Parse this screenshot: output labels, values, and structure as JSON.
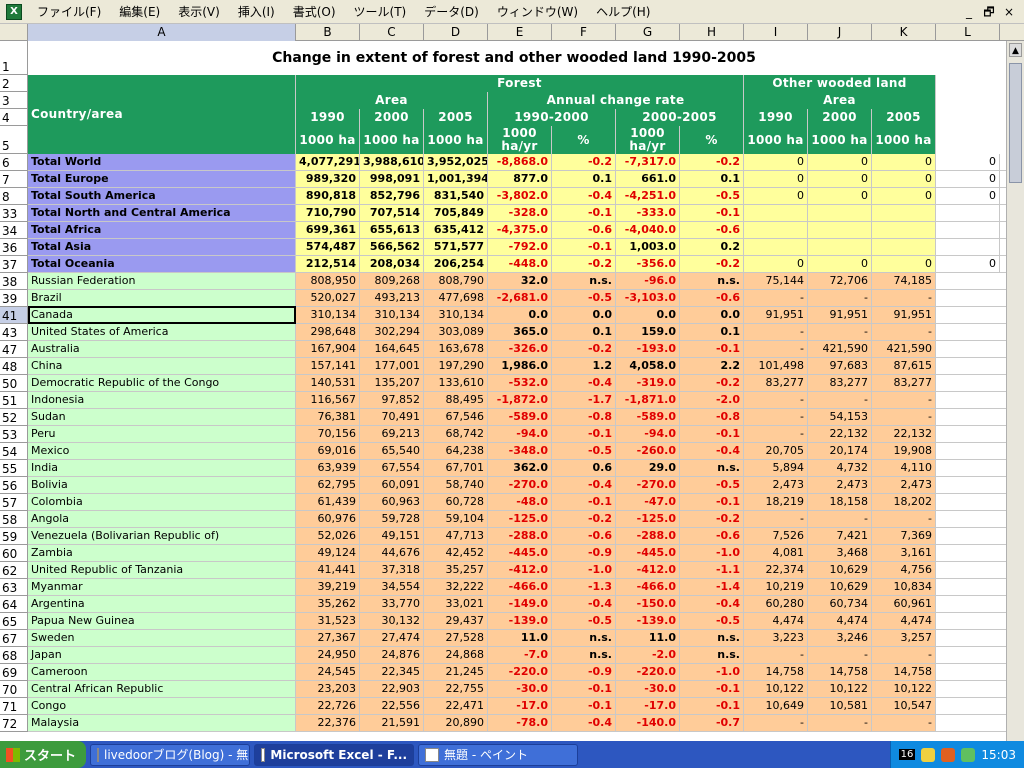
{
  "menubar": {
    "items": [
      "ファイル(F)",
      "編集(E)",
      "表示(V)",
      "挿入(I)",
      "書式(O)",
      "ツール(T)",
      "データ(D)",
      "ウィンドウ(W)",
      "ヘルプ(H)"
    ],
    "app_icon": "excel-icon",
    "controls": [
      "_",
      "🗗",
      "×"
    ]
  },
  "columns": [
    {
      "label": "A",
      "selected": true
    },
    {
      "label": "B"
    },
    {
      "label": "C"
    },
    {
      "label": "D"
    },
    {
      "label": "E"
    },
    {
      "label": "F"
    },
    {
      "label": "G"
    },
    {
      "label": "H"
    },
    {
      "label": "I"
    },
    {
      "label": "J"
    },
    {
      "label": "K"
    },
    {
      "label": "L"
    }
  ],
  "title": "Change in extent of forest and other wooded land 1990-2005",
  "header": {
    "country_area": "Country/area",
    "forest": "Forest",
    "other_wooded_land": "Other wooded land",
    "area": "Area",
    "annual_change_rate": "Annual change rate",
    "area2": "Area",
    "years": [
      "1990",
      "2000",
      "2005"
    ],
    "period1": "1990-2000",
    "period2": "2000-2005",
    "years2": [
      "1990",
      "2000",
      "2005"
    ],
    "unit_ha": "1000 ha",
    "unit_hayr": "1000 ha/yr",
    "unit_pct": "%"
  },
  "header_row_numbers": [
    "1",
    "2",
    "3",
    "4",
    "5"
  ],
  "totals": [
    {
      "row": "6",
      "name": "Total World",
      "b": "4,077,291",
      "c": "3,988,610",
      "d": "3,952,025",
      "e": "-8,868.0",
      "f": "-0.2",
      "g": "-7,317.0",
      "h": "-0.2",
      "i": "0",
      "j": "0",
      "k": "0",
      "l": "0"
    },
    {
      "row": "7",
      "name": "Total Europe",
      "b": "989,320",
      "c": "998,091",
      "d": "1,001,394",
      "e": "877.0",
      "f": "0.1",
      "g": "661.0",
      "h": "0.1",
      "i": "0",
      "j": "0",
      "k": "0",
      "l": "0"
    },
    {
      "row": "8",
      "name": "Total South America",
      "b": "890,818",
      "c": "852,796",
      "d": "831,540",
      "e": "-3,802.0",
      "f": "-0.4",
      "g": "-4,251.0",
      "h": "-0.5",
      "i": "0",
      "j": "0",
      "k": "0",
      "l": "0"
    },
    {
      "row": "33",
      "name": "Total North and Central America",
      "b": "710,790",
      "c": "707,514",
      "d": "705,849",
      "e": "-328.0",
      "f": "-0.1",
      "g": "-333.0",
      "h": "-0.1",
      "i": "",
      "j": "",
      "k": "",
      "l": ""
    },
    {
      "row": "34",
      "name": "Total Africa",
      "b": "699,361",
      "c": "655,613",
      "d": "635,412",
      "e": "-4,375.0",
      "f": "-0.6",
      "g": "-4,040.0",
      "h": "-0.6",
      "i": "",
      "j": "",
      "k": "",
      "l": ""
    },
    {
      "row": "36",
      "name": "Total Asia",
      "b": "574,487",
      "c": "566,562",
      "d": "571,577",
      "e": "-792.0",
      "f": "-0.1",
      "g": "1,003.0",
      "h": "0.2",
      "i": "",
      "j": "",
      "k": "",
      "l": ""
    },
    {
      "row": "37",
      "name": "Total Oceania",
      "b": "212,514",
      "c": "208,034",
      "d": "206,254",
      "e": "-448.0",
      "f": "-0.2",
      "g": "-356.0",
      "h": "-0.2",
      "i": "0",
      "j": "0",
      "k": "0",
      "l": "0"
    }
  ],
  "countries": [
    {
      "row": "38",
      "name": "Russian Federation",
      "b": "808,950",
      "c": "809,268",
      "d": "808,790",
      "e": "32.0",
      "f": "n.s.",
      "g": "-96.0",
      "h": "n.s.",
      "i": "75,144",
      "j": "72,706",
      "k": "74,185"
    },
    {
      "row": "39",
      "name": "Brazil",
      "b": "520,027",
      "c": "493,213",
      "d": "477,698",
      "e": "-2,681.0",
      "f": "-0.5",
      "g": "-3,103.0",
      "h": "-0.6",
      "i": "-",
      "j": "-",
      "k": "-"
    },
    {
      "row": "41",
      "name": "Canada",
      "b": "310,134",
      "c": "310,134",
      "d": "310,134",
      "e": "0.0",
      "f": "0.0",
      "g": "0.0",
      "h": "0.0",
      "i": "91,951",
      "j": "91,951",
      "k": "91,951"
    },
    {
      "row": "43",
      "name": "United States of America",
      "b": "298,648",
      "c": "302,294",
      "d": "303,089",
      "e": "365.0",
      "f": "0.1",
      "g": "159.0",
      "h": "0.1",
      "i": "-",
      "j": "-",
      "k": "-"
    },
    {
      "row": "47",
      "name": "Australia",
      "b": "167,904",
      "c": "164,645",
      "d": "163,678",
      "e": "-326.0",
      "f": "-0.2",
      "g": "-193.0",
      "h": "-0.1",
      "i": "-",
      "j": "421,590",
      "k": "421,590"
    },
    {
      "row": "48",
      "name": "China",
      "b": "157,141",
      "c": "177,001",
      "d": "197,290",
      "e": "1,986.0",
      "f": "1.2",
      "g": "4,058.0",
      "h": "2.2",
      "i": "101,498",
      "j": "97,683",
      "k": "87,615"
    },
    {
      "row": "50",
      "name": "Democratic Republic of the Congo",
      "b": "140,531",
      "c": "135,207",
      "d": "133,610",
      "e": "-532.0",
      "f": "-0.4",
      "g": "-319.0",
      "h": "-0.2",
      "i": "83,277",
      "j": "83,277",
      "k": "83,277"
    },
    {
      "row": "51",
      "name": "Indonesia",
      "b": "116,567",
      "c": "97,852",
      "d": "88,495",
      "e": "-1,872.0",
      "f": "-1.7",
      "g": "-1,871.0",
      "h": "-2.0",
      "i": "-",
      "j": "-",
      "k": "-"
    },
    {
      "row": "52",
      "name": "Sudan",
      "b": "76,381",
      "c": "70,491",
      "d": "67,546",
      "e": "-589.0",
      "f": "-0.8",
      "g": "-589.0",
      "h": "-0.8",
      "i": "-",
      "j": "54,153",
      "k": "-"
    },
    {
      "row": "53",
      "name": "Peru",
      "b": "70,156",
      "c": "69,213",
      "d": "68,742",
      "e": "-94.0",
      "f": "-0.1",
      "g": "-94.0",
      "h": "-0.1",
      "i": "-",
      "j": "22,132",
      "k": "22,132"
    },
    {
      "row": "54",
      "name": "Mexico",
      "b": "69,016",
      "c": "65,540",
      "d": "64,238",
      "e": "-348.0",
      "f": "-0.5",
      "g": "-260.0",
      "h": "-0.4",
      "i": "20,705",
      "j": "20,174",
      "k": "19,908"
    },
    {
      "row": "55",
      "name": "India",
      "b": "63,939",
      "c": "67,554",
      "d": "67,701",
      "e": "362.0",
      "f": "0.6",
      "g": "29.0",
      "h": "n.s.",
      "i": "5,894",
      "j": "4,732",
      "k": "4,110"
    },
    {
      "row": "56",
      "name": "Bolivia",
      "b": "62,795",
      "c": "60,091",
      "d": "58,740",
      "e": "-270.0",
      "f": "-0.4",
      "g": "-270.0",
      "h": "-0.5",
      "i": "2,473",
      "j": "2,473",
      "k": "2,473"
    },
    {
      "row": "57",
      "name": "Colombia",
      "b": "61,439",
      "c": "60,963",
      "d": "60,728",
      "e": "-48.0",
      "f": "-0.1",
      "g": "-47.0",
      "h": "-0.1",
      "i": "18,219",
      "j": "18,158",
      "k": "18,202"
    },
    {
      "row": "58",
      "name": "Angola",
      "b": "60,976",
      "c": "59,728",
      "d": "59,104",
      "e": "-125.0",
      "f": "-0.2",
      "g": "-125.0",
      "h": "-0.2",
      "i": "-",
      "j": "-",
      "k": "-"
    },
    {
      "row": "59",
      "name": "Venezuela (Bolivarian Republic of)",
      "b": "52,026",
      "c": "49,151",
      "d": "47,713",
      "e": "-288.0",
      "f": "-0.6",
      "g": "-288.0",
      "h": "-0.6",
      "i": "7,526",
      "j": "7,421",
      "k": "7,369"
    },
    {
      "row": "60",
      "name": "Zambia",
      "b": "49,124",
      "c": "44,676",
      "d": "42,452",
      "e": "-445.0",
      "f": "-0.9",
      "g": "-445.0",
      "h": "-1.0",
      "i": "4,081",
      "j": "3,468",
      "k": "3,161"
    },
    {
      "row": "62",
      "name": "United Republic of Tanzania",
      "b": "41,441",
      "c": "37,318",
      "d": "35,257",
      "e": "-412.0",
      "f": "-1.0",
      "g": "-412.0",
      "h": "-1.1",
      "i": "22,374",
      "j": "10,629",
      "k": "4,756"
    },
    {
      "row": "63",
      "name": "Myanmar",
      "b": "39,219",
      "c": "34,554",
      "d": "32,222",
      "e": "-466.0",
      "f": "-1.3",
      "g": "-466.0",
      "h": "-1.4",
      "i": "10,219",
      "j": "10,629",
      "k": "10,834"
    },
    {
      "row": "64",
      "name": "Argentina",
      "b": "35,262",
      "c": "33,770",
      "d": "33,021",
      "e": "-149.0",
      "f": "-0.4",
      "g": "-150.0",
      "h": "-0.4",
      "i": "60,280",
      "j": "60,734",
      "k": "60,961"
    },
    {
      "row": "65",
      "name": "Papua New Guinea",
      "b": "31,523",
      "c": "30,132",
      "d": "29,437",
      "e": "-139.0",
      "f": "-0.5",
      "g": "-139.0",
      "h": "-0.5",
      "i": "4,474",
      "j": "4,474",
      "k": "4,474"
    },
    {
      "row": "67",
      "name": "Sweden",
      "b": "27,367",
      "c": "27,474",
      "d": "27,528",
      "e": "11.0",
      "f": "n.s.",
      "g": "11.0",
      "h": "n.s.",
      "i": "3,223",
      "j": "3,246",
      "k": "3,257"
    },
    {
      "row": "68",
      "name": "Japan",
      "b": "24,950",
      "c": "24,876",
      "d": "24,868",
      "e": "-7.0",
      "f": "n.s.",
      "g": "-2.0",
      "h": "n.s.",
      "i": "-",
      "j": "-",
      "k": "-"
    },
    {
      "row": "69",
      "name": "Cameroon",
      "b": "24,545",
      "c": "22,345",
      "d": "21,245",
      "e": "-220.0",
      "f": "-0.9",
      "g": "-220.0",
      "h": "-1.0",
      "i": "14,758",
      "j": "14,758",
      "k": "14,758"
    },
    {
      "row": "70",
      "name": "Central African Republic",
      "b": "23,203",
      "c": "22,903",
      "d": "22,755",
      "e": "-30.0",
      "f": "-0.1",
      "g": "-30.0",
      "h": "-0.1",
      "i": "10,122",
      "j": "10,122",
      "k": "10,122"
    },
    {
      "row": "71",
      "name": "Congo",
      "b": "22,726",
      "c": "22,556",
      "d": "22,471",
      "e": "-17.0",
      "f": "-0.1",
      "g": "-17.0",
      "h": "-0.1",
      "i": "10,649",
      "j": "10,581",
      "k": "10,547"
    },
    {
      "row": "72",
      "name": "Malaysia",
      "b": "22,376",
      "c": "21,591",
      "d": "20,890",
      "e": "-78.0",
      "f": "-0.4",
      "g": "-140.0",
      "h": "-0.7",
      "i": "-",
      "j": "-",
      "k": "-"
    }
  ],
  "selected_row": "41",
  "taskbar": {
    "start": "スタート",
    "tasks": [
      {
        "label": "livedoorブログ(Blog) - 無...",
        "icon": "browser-icon",
        "active": false
      },
      {
        "label": "Microsoft Excel - F...",
        "icon": "excel-icon",
        "active": true
      },
      {
        "label": "無題 - ペイント",
        "icon": "paint-icon",
        "active": false
      }
    ],
    "tray_badge": "16",
    "clock": "15:03"
  }
}
